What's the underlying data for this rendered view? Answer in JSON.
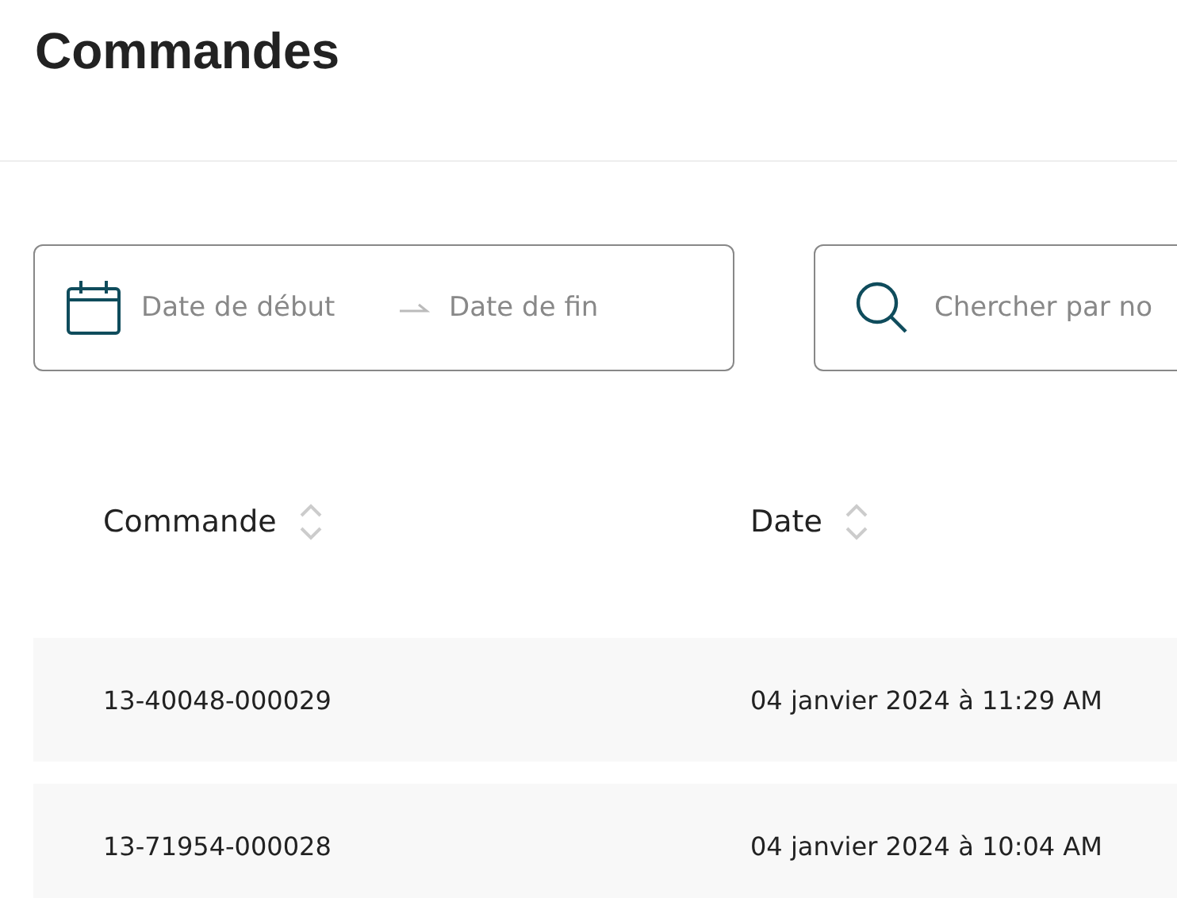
{
  "page": {
    "title": "Commandes"
  },
  "filters": {
    "start_date": {
      "placeholder": "Date de début"
    },
    "end_date": {
      "placeholder": "Date de fin"
    },
    "search": {
      "placeholder": "Chercher par no"
    }
  },
  "table": {
    "columns": [
      {
        "label": "Commande"
      },
      {
        "label": "Date"
      }
    ],
    "rows": [
      {
        "order": "13-40048-000029",
        "date": "04 janvier 2024 à 11:29 AM"
      },
      {
        "order": "13-71954-000028",
        "date": "04 janvier 2024 à 10:04 AM"
      }
    ]
  }
}
